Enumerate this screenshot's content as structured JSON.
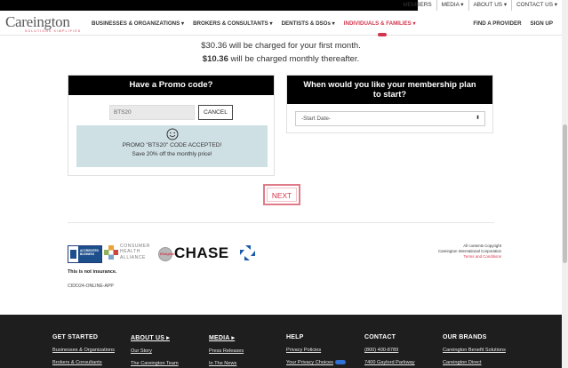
{
  "utility_nav": [
    "MEMBERS",
    "MEDIA ▾",
    "ABOUT US ▾",
    "CONTACT US ▾"
  ],
  "logo": {
    "name": "Careington",
    "tagline": "SOLUTIONS SIMPLIFIED"
  },
  "main_nav": [
    {
      "label": "BUSINESSES & ORGANIZATIONS ▾",
      "active": false
    },
    {
      "label": "BROKERS & CONSULTANTS ▾",
      "active": false
    },
    {
      "label": "DENTISTS & DSOs ▾",
      "active": false
    },
    {
      "label": "INDIVIDUALS & FAMILIES ▾",
      "active": true
    }
  ],
  "right_nav": {
    "find_provider": "FIND A PROVIDER",
    "sign_up": "SIGN UP"
  },
  "pricing": {
    "first_month": "$30.36 will be charged for your first month.",
    "monthly_amount": "$10.36",
    "monthly_text": " will be charged monthly thereafter."
  },
  "promo": {
    "heading": "Have a Promo code?",
    "code_value": "BTS20",
    "cancel_label": "CANCEL",
    "accepted_text": "PROMO \"BTS20\" CODE ACCEPTED!",
    "discount_text": "Save 20% off the monthly price!"
  },
  "membership": {
    "heading_line1": "When would you like your membership plan",
    "heading_line2": "to start?",
    "start_date_selected": "-Start Date-"
  },
  "next_label": "NEXT",
  "badges": {
    "bbb_line1": "ACCREDITED",
    "bbb_line2": "BUSINESS",
    "chc_line1": "CONSUMER",
    "chc_line2": "HEALTH",
    "chc_line3": "ALLIANCE",
    "ehc": "Ethisphere",
    "chase": "CHASE"
  },
  "disclaimer": "This is not insurance.",
  "app_code": "CIDO24-ONLINE-APP",
  "copyright": {
    "line1": "All contents Copyright",
    "line2": "Careington International Corporation",
    "terms": "Terms and Conditions"
  },
  "footer": {
    "get_started": {
      "heading": "GET STARTED",
      "links": [
        "Businesses & Organizations",
        "Brokers & Consultants"
      ]
    },
    "about": {
      "heading": "ABOUT US ▸",
      "links": [
        "Our Story",
        "The Careington Team"
      ]
    },
    "media": {
      "heading": "MEDIA ▸",
      "links": [
        "Press Releases",
        "In The News"
      ]
    },
    "help": {
      "heading": "HELP",
      "links": [
        "Privacy Policies",
        "Your Privacy Choices"
      ]
    },
    "contact": {
      "heading": "CONTACT",
      "links": [
        "(800) 400-8789",
        "7400 Gaylord Parkway"
      ]
    },
    "brands": {
      "heading": "OUR BRANDS",
      "links": [
        "Careington Benefit Solutions",
        "Careington Direct"
      ]
    }
  },
  "colors": {
    "brand_red": "#d2364d",
    "panel_black": "#000000",
    "accepted_bg": "#cfe0e5",
    "footer_bg": "#1e1e1e"
  }
}
